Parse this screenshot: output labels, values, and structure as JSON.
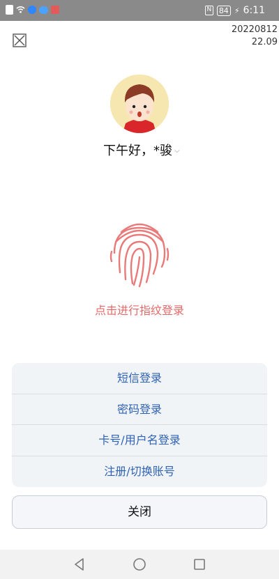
{
  "status_bar": {
    "time": "6:11",
    "battery": "84",
    "nfc": "N",
    "icons": [
      "notification-icon",
      "wifi-icon",
      "search-app-icon",
      "cloud-app-icon",
      "book-app-icon"
    ]
  },
  "header": {
    "date_code": "20220812",
    "version": "22.09",
    "close_icon": "close-x-icon"
  },
  "profile": {
    "greeting": "下午好，*骏"
  },
  "fingerprint": {
    "label": "点击进行指纹登录",
    "color": "#e46a6a"
  },
  "login_options": [
    {
      "label": "短信登录"
    },
    {
      "label": "密码登录"
    },
    {
      "label": "卡号/用户名登录"
    },
    {
      "label": "注册/切换账号"
    }
  ],
  "close_button": {
    "label": "关闭"
  },
  "colors": {
    "accent": "#2f62b5",
    "status_bar": "#8a8a8a"
  }
}
